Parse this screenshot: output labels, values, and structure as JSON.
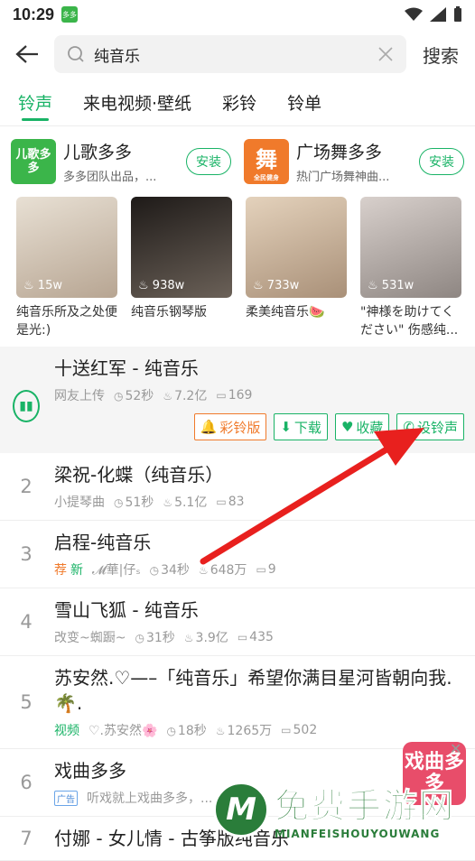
{
  "status": {
    "time": "10:29",
    "app_icon_text": "多多"
  },
  "search": {
    "value": "纯音乐",
    "button": "搜索"
  },
  "tabs": [
    {
      "label": "铃声"
    },
    {
      "label": "来电视频·壁纸"
    },
    {
      "label": "彩铃"
    },
    {
      "label": "铃单"
    }
  ],
  "apps": [
    {
      "name": "儿歌多多",
      "desc": "多多团队出品，...",
      "install": "安装",
      "icon_text": "儿歌多多",
      "color": "#3bb54a"
    },
    {
      "name": "广场舞多多",
      "desc": "热门广场舞神曲...",
      "install": "安装",
      "icon_text": "舞",
      "sub": "全民健身",
      "color": "#f07a2b"
    }
  ],
  "thumbs": [
    {
      "plays": "15w",
      "caption": "纯音乐所及之处便是光:)",
      "color": "#c7b8a8"
    },
    {
      "plays": "938w",
      "caption": "纯音乐钢琴版",
      "color": "#3a3430"
    },
    {
      "plays": "733w",
      "caption": "柔美纯音乐🍉",
      "color": "#d8c2a8"
    },
    {
      "plays": "531w",
      "caption": "\"神様を助けてください\" 伤感纯...",
      "color": "#bfb5b0"
    }
  ],
  "songs": [
    {
      "num": "",
      "title": "十送红军 - 纯音乐",
      "source": "网友上传",
      "duration": "52秒",
      "hot": "7.2亿",
      "comments": "169",
      "active": true
    },
    {
      "num": "2",
      "title": "梁祝-化蝶（纯音乐）",
      "source": "小提琴曲",
      "duration": "51秒",
      "hot": "5.1亿",
      "comments": "83"
    },
    {
      "num": "3",
      "title": "启程-纯音乐",
      "tags": [
        "荐",
        "新"
      ],
      "source": "𝓜華|仔ₛ",
      "duration": "34秒",
      "hot": "648万",
      "comments": "9"
    },
    {
      "num": "4",
      "title": "雪山飞狐 - 纯音乐",
      "source": "改变~蜘蹰~",
      "duration": "31秒",
      "hot": "3.9亿",
      "comments": "435"
    },
    {
      "num": "5",
      "title": "苏安然.♡—–「纯音乐」希望你满目星河皆朝向我.🌴.",
      "tag_video": "视频",
      "source": "♡.苏安然🌸",
      "duration": "18秒",
      "hot": "1265万",
      "comments": "502"
    },
    {
      "num": "6",
      "title": "戏曲多多",
      "ad": "广告",
      "source": "听戏就上戏曲多多，..."
    },
    {
      "num": "7",
      "title": "付娜 - 女儿情 - 古筝版纯音乐"
    }
  ],
  "actions": {
    "ringback": "彩铃版",
    "download": "下载",
    "favorite": "收藏",
    "set_ringtone": "设铃声"
  },
  "float_ad": {
    "text": "戏曲多多"
  },
  "watermark": {
    "cn": "免费手游网",
    "en": "MIANFEISHOUYOUWANG",
    "logo": "M"
  }
}
